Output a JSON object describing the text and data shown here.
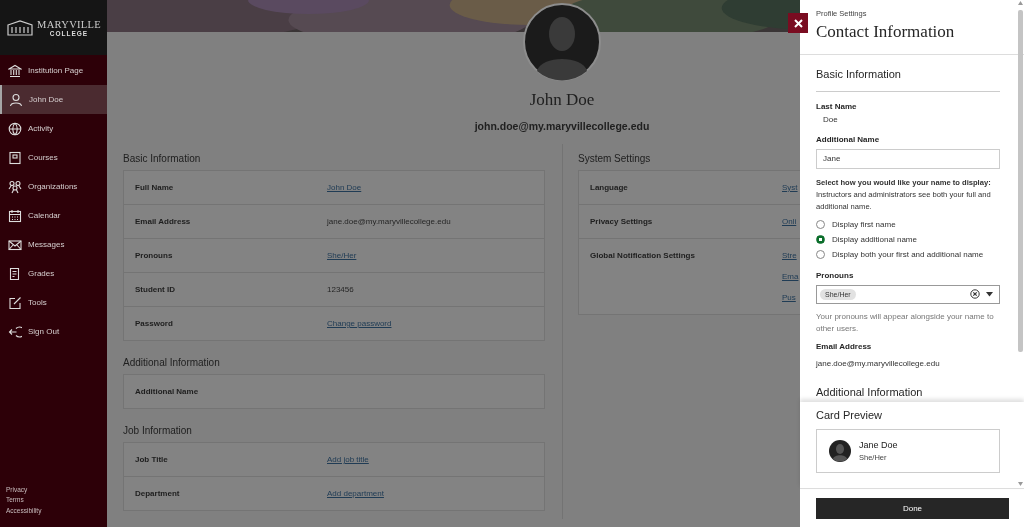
{
  "sidebar": {
    "logo": {
      "name": "MARYVILLE",
      "sub": "COLLEGE"
    },
    "items": [
      {
        "label": "Institution Page",
        "selected": false
      },
      {
        "label": "John Doe",
        "selected": true
      },
      {
        "label": "Activity",
        "selected": false
      },
      {
        "label": "Courses",
        "selected": false
      },
      {
        "label": "Organizations",
        "selected": false
      },
      {
        "label": "Calendar",
        "selected": false
      },
      {
        "label": "Messages",
        "selected": false
      },
      {
        "label": "Grades",
        "selected": false
      },
      {
        "label": "Tools",
        "selected": false
      },
      {
        "label": "Sign Out",
        "selected": false
      }
    ],
    "footer_links": [
      "Privacy",
      "Terms",
      "Accessibility"
    ]
  },
  "profile": {
    "name": "John Doe",
    "email": "john.doe@my.maryvillecollege.edu"
  },
  "sections": [
    {
      "title": "Basic Information",
      "rows": [
        {
          "label": "Full Name",
          "values": [
            {
              "text": "John Doe",
              "kind": "link"
            }
          ]
        },
        {
          "label": "Email Address",
          "values": [
            {
              "text": "jane.doe@my.maryvillecollege.edu",
              "kind": "text"
            }
          ]
        },
        {
          "label": "Pronouns",
          "values": [
            {
              "text": "She/Her",
              "kind": "link"
            }
          ]
        },
        {
          "label": "Student ID",
          "values": [
            {
              "text": "123456",
              "kind": "text"
            }
          ]
        },
        {
          "label": "Password",
          "values": [
            {
              "text": "Change password",
              "kind": "link"
            }
          ]
        }
      ]
    },
    {
      "title": "Additional Information",
      "rows": [
        {
          "label": "Additional Name",
          "values": []
        }
      ]
    },
    {
      "title": "Job Information",
      "rows": [
        {
          "label": "Job Title",
          "values": [
            {
              "text": "Add job title",
              "kind": "link"
            }
          ]
        },
        {
          "label": "Department",
          "values": [
            {
              "text": "Add department",
              "kind": "link"
            }
          ]
        }
      ]
    }
  ],
  "system_settings": {
    "title": "System Settings",
    "rows": [
      {
        "label": "Language",
        "values": [
          {
            "text": "Syst",
            "kind": "link"
          }
        ]
      },
      {
        "label": "Privacy Settings",
        "values": [
          {
            "text": "Onli",
            "kind": "link"
          }
        ]
      },
      {
        "label": "Global Notification Settings",
        "values": [
          {
            "text": "Stre",
            "kind": "link"
          },
          {
            "text": "Ema",
            "kind": "link"
          },
          {
            "text": "Pus",
            "kind": "link"
          }
        ]
      }
    ]
  },
  "panel": {
    "breadcrumb": "Profile Settings",
    "title": "Contact Information",
    "section_title": "Basic Information",
    "last_name": {
      "label": "Last Name",
      "value": "Doe"
    },
    "additional_name": {
      "label": "Additional Name",
      "value": "Jane"
    },
    "display_prompt": "**Select how you would like your name to display:** Instructors and administrators see both your full and additional name.",
    "display_options": [
      {
        "label": "Display first name",
        "selected": false
      },
      {
        "label": "Display additional name",
        "selected": true
      },
      {
        "label": "Display both your first and additional name",
        "selected": false
      }
    ],
    "pronouns": {
      "label": "Pronouns",
      "chip": "She/Her",
      "help": "Your pronouns will appear alongside your name to other users."
    },
    "email": {
      "label": "Email Address",
      "value": "jane.doe@my.maryvillecollege.edu"
    },
    "next_section": "Additional Information",
    "card_preview": {
      "title": "Card Preview",
      "name": "Jane Doe",
      "pronouns": "She/Her"
    },
    "done": "Done"
  }
}
